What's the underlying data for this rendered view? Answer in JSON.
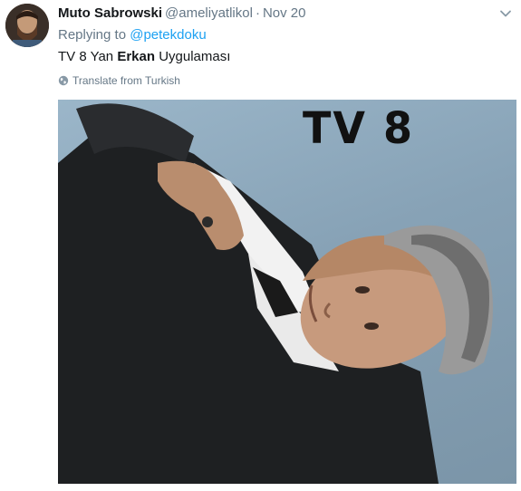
{
  "tweet": {
    "author_name": "Muto Sabrowski",
    "author_handle": "@ameliyatlikol",
    "separator": "·",
    "date": "Nov 20",
    "replying_prefix": "Replying to",
    "replying_to": "@petekdoku",
    "text_before": "TV 8 Yan",
    "text_bold": "Erkan",
    "text_after": "Uygulaması",
    "translate_label": "Translate from Turkish",
    "image_overlay_text": "TV 8"
  },
  "icons": {
    "caret": "chevron-down-icon",
    "translate": "globe-icon"
  },
  "colors": {
    "link": "#1da1f2",
    "secondary_text": "#657786",
    "primary_text": "#14171a"
  }
}
